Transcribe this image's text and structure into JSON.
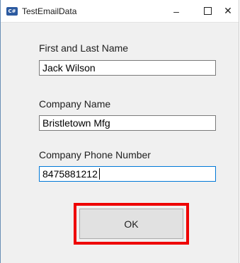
{
  "window": {
    "title": "TestEmailData",
    "icon": "app-icon",
    "icon_text": "C#"
  },
  "titlebar_buttons": {
    "minimize": "–",
    "maximize": "□",
    "close": "✕"
  },
  "form": {
    "name_label": "First and Last Name",
    "name_value": "Jack Wilson",
    "company_label": "Company Name",
    "company_value": "Bristletown Mfg",
    "phone_label": "Company Phone Number",
    "phone_value": "8475881212"
  },
  "actions": {
    "ok_label": "OK"
  },
  "colors": {
    "highlight": "#ee0000",
    "focus_border": "#0078d7"
  }
}
